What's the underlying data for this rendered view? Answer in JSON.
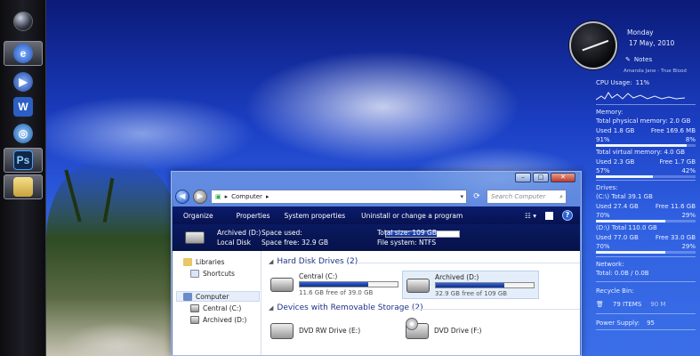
{
  "gadgets": {
    "day": "Monday",
    "date": "17 May, 2010",
    "notes_label": "Notes",
    "now_playing": "Amanda Jane - True Blood",
    "cpu": {
      "label": "CPU Usage:",
      "value": "11%"
    },
    "memory": {
      "title": "Memory:",
      "physical_total": "Total physical memory: 2.0 GB",
      "physical_used": "Used 1.8 GB",
      "physical_free": "Free 169.6 MB",
      "physical_used_pct": "91%",
      "physical_free_pct": "8%",
      "virtual_total": "Total virtual memory: 4.0 GB",
      "virtual_used": "Used 2.3 GB",
      "virtual_free": "Free 1.7 GB",
      "virtual_used_pct": "57%",
      "virtual_free_pct": "42%"
    },
    "drives": {
      "title": "Drives:",
      "c_total": "(C:\\) Total 39.1 GB",
      "c_used": "Used 27.4 GB",
      "c_free": "Free 11.6 GB",
      "c_used_pct": "70%",
      "c_free_pct": "29%",
      "d_total": "(D:\\) Total 110.0 GB",
      "d_used": "Used 77.0 GB",
      "d_free": "Free 33.0 GB",
      "d_used_pct": "70%",
      "d_free_pct": "29%"
    },
    "network": {
      "title": "Network:",
      "value": "Total: 0.0B / 0.0B"
    },
    "recycle": {
      "title": "Recycle Bin:",
      "items": "79 ITEMS",
      "size": "90 M"
    },
    "power": {
      "label": "Power Supply:",
      "value": "95"
    }
  },
  "explorer": {
    "address": "Computer",
    "search_placeholder": "Search Computer",
    "commands": [
      "Organize",
      "Properties",
      "System properties",
      "Uninstall or change a program"
    ],
    "details": {
      "drive_name": "Archived (D:)",
      "drive_type": "Local Disk",
      "space_used_label": "Space used:",
      "space_free": "Space free: 32.9 GB",
      "total_size": "Total size: 109 GB",
      "file_system": "File system: NTFS",
      "used_fraction": 0.7
    },
    "nav": {
      "libraries": "Libraries",
      "shortcuts": "Shortcuts",
      "computer": "Computer",
      "central": "Central (C:)",
      "archived": "Archived (D:)"
    },
    "hdd_group": "Hard Disk Drives (2)",
    "removable_group": "Devices with Removable Storage (2)",
    "drives": [
      {
        "name": "Central (C:)",
        "free": "11.6 GB free of 39.0 GB",
        "used_fraction": 0.7
      },
      {
        "name": "Archived (D:)",
        "free": "32.9 GB free of 109 GB",
        "used_fraction": 0.7
      }
    ],
    "removable": [
      "DVD RW Drive (E:)",
      "DVD Drive (F:)"
    ]
  },
  "colors": {
    "accent": "#0b1c6e",
    "desktop": "#1b3fc4"
  }
}
